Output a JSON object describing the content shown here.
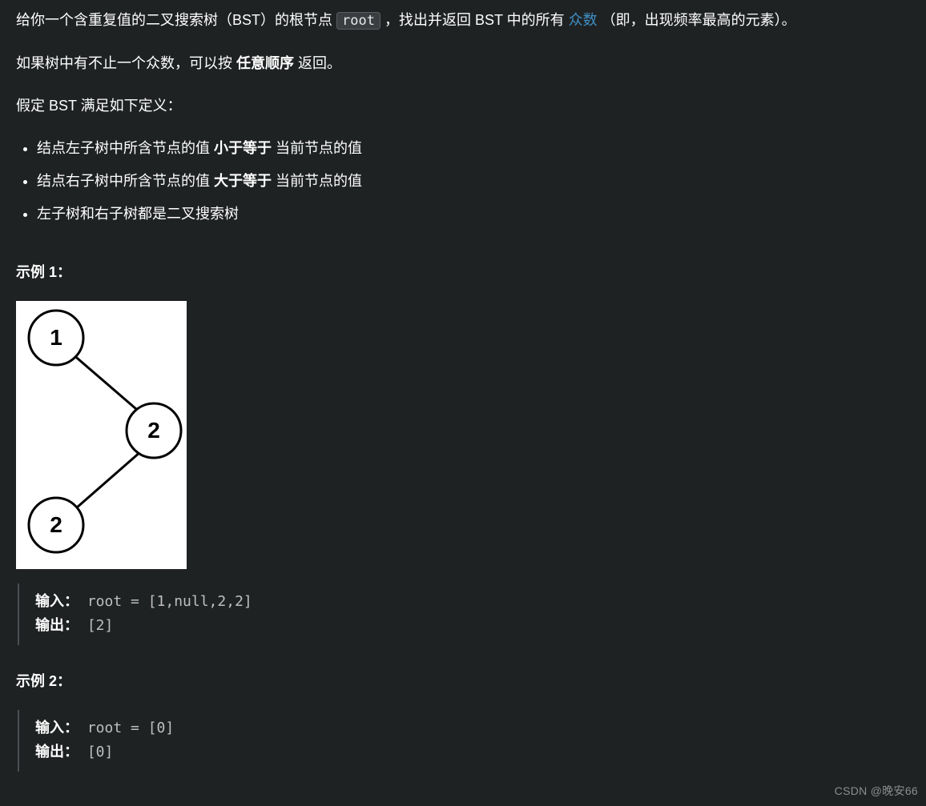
{
  "intro": {
    "p1_a": "给你一个含重复值的二叉搜索树（BST）的根节点 ",
    "root_code": "root",
    "p1_b": " ，找出并返回 BST 中的所有 ",
    "mode_link": "众数",
    "p1_c": "（即，出现频率最高的元素）。",
    "p2_a": "如果树中有不止一个众数，可以按 ",
    "p2_bold": "任意顺序",
    "p2_b": " 返回。",
    "p3": "假定 BST 满足如下定义："
  },
  "defs": {
    "li1_a": "结点左子树中所含节点的值 ",
    "li1_bold": "小于等于",
    "li1_b": " 当前节点的值",
    "li2_a": "结点右子树中所含节点的值 ",
    "li2_bold": "大于等于",
    "li2_b": " 当前节点的值",
    "li3": "左子树和右子树都是二叉搜索树"
  },
  "tree": {
    "n1": "1",
    "n2": "2",
    "n3": "2"
  },
  "ex1": {
    "title": "示例 1：",
    "input_label": "输入：",
    "input_value": "root = [1,null,2,2]",
    "output_label": "输出：",
    "output_value": "[2]"
  },
  "ex2": {
    "title": "示例 2：",
    "input_label": "输入：",
    "input_value": "root = [0]",
    "output_label": "输出：",
    "output_value": "[0]"
  },
  "watermark": "CSDN @晚安66"
}
